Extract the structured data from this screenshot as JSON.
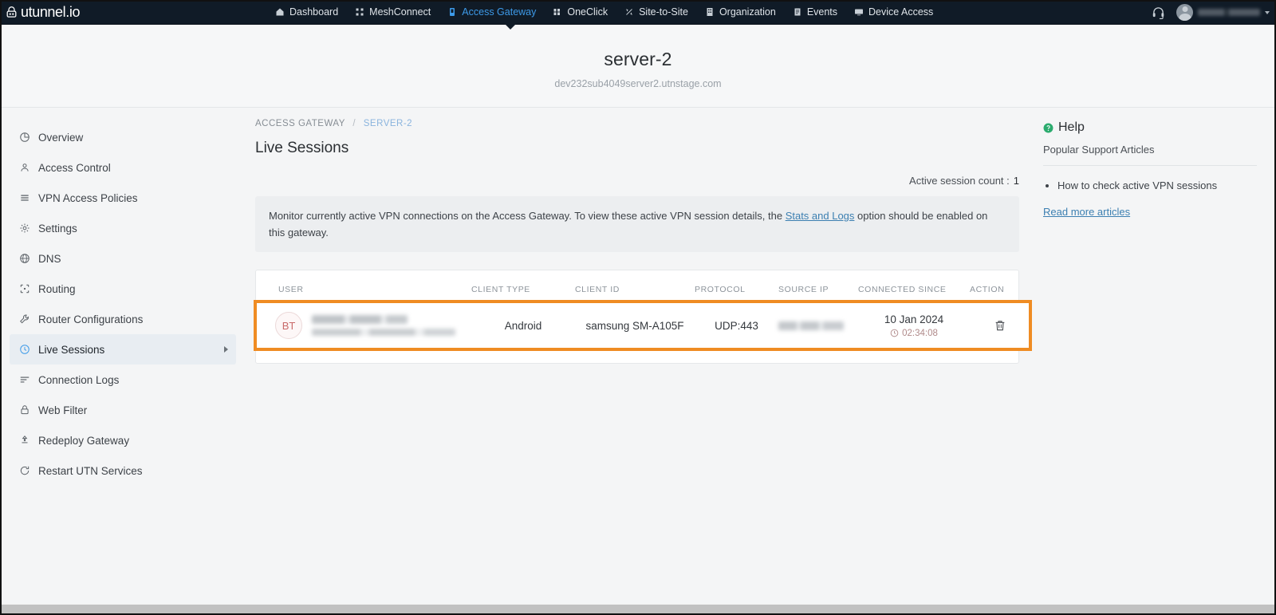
{
  "navbar": {
    "brand": "utunnel.io",
    "links": [
      {
        "label": "Dashboard",
        "icon": "home-icon",
        "active": false
      },
      {
        "label": "MeshConnect",
        "icon": "mesh-icon",
        "active": false
      },
      {
        "label": "Access Gateway",
        "icon": "gateway-icon",
        "active": true
      },
      {
        "label": "OneClick",
        "icon": "oneclick-icon",
        "active": false
      },
      {
        "label": "Site-to-Site",
        "icon": "site-to-site-icon",
        "active": false
      },
      {
        "label": "Organization",
        "icon": "organization-icon",
        "active": false
      },
      {
        "label": "Events",
        "icon": "events-icon",
        "active": false
      },
      {
        "label": "Device Access",
        "icon": "device-access-icon",
        "active": false
      }
    ],
    "support_icon": "headset-icon",
    "user_menu_icon": "chevron-down-icon"
  },
  "hero": {
    "title": "server-2",
    "subtitle": "dev232sub4049server2.utnstage.com"
  },
  "sidebar": {
    "items": [
      {
        "label": "Overview",
        "icon": "pie-chart-icon",
        "active": false
      },
      {
        "label": "Access Control",
        "icon": "user-icon",
        "active": false
      },
      {
        "label": "VPN Access Policies",
        "icon": "list-icon",
        "active": false
      },
      {
        "label": "Settings",
        "icon": "gear-icon",
        "active": false
      },
      {
        "label": "DNS",
        "icon": "globe-icon",
        "active": false
      },
      {
        "label": "Routing",
        "icon": "routing-icon",
        "active": false
      },
      {
        "label": "Router Configurations",
        "icon": "wrench-icon",
        "active": false
      },
      {
        "label": "Live Sessions",
        "icon": "clock-icon",
        "active": true
      },
      {
        "label": "Connection Logs",
        "icon": "logs-icon",
        "active": false
      },
      {
        "label": "Web Filter",
        "icon": "lock-icon",
        "active": false
      },
      {
        "label": "Redeploy Gateway",
        "icon": "deploy-icon",
        "active": false
      },
      {
        "label": "Restart UTN Services",
        "icon": "restart-icon",
        "active": false
      }
    ]
  },
  "main": {
    "breadcrumb": {
      "root": "ACCESS GATEWAY",
      "separator": "/",
      "current": "SERVER-2"
    },
    "page_title": "Live Sessions",
    "active_session_count_label": "Active session count :",
    "active_session_count_value": "1",
    "banner": {
      "text_before": "Monitor currently active VPN connections on the Access Gateway. To view these active VPN session details, the",
      "link": "Stats and Logs",
      "text_after": "option should be enabled on this gateway."
    },
    "table": {
      "columns": [
        "USER",
        "CLIENT TYPE",
        "CLIENT ID",
        "PROTOCOL",
        "SOURCE IP",
        "CONNECTED SINCE",
        "ACTION"
      ],
      "rows": [
        {
          "avatar_initials": "BT",
          "user_name": "",
          "user_email": "",
          "client_type": "Android",
          "client_id": "samsung SM-A105F",
          "protocol": "UDP:443",
          "source_ip": "",
          "connected_date": "10 Jan 2024",
          "connected_duration": "02:34:08",
          "action_icon": "trash-icon",
          "highlighted": true
        }
      ]
    }
  },
  "help": {
    "icon": "question-circle-icon",
    "title": "Help",
    "subtitle": "Popular Support Articles",
    "articles": [
      "How to check active VPN sessions"
    ],
    "more_link": "Read more articles"
  },
  "colors": {
    "navbar_bg": "#101b27",
    "nav_active": "#3d9ae8",
    "highlight_border": "#ef8c23",
    "link": "#3c7fb1",
    "help_icon": "#2bab6e",
    "avatar_initials": "#c96a6a"
  }
}
